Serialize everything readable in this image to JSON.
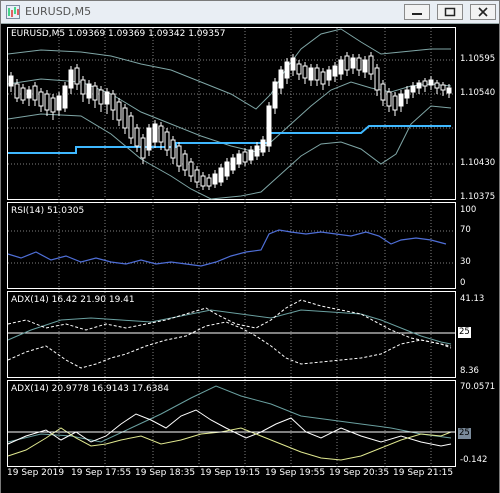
{
  "window": {
    "title": "EURUSD,M5",
    "buttons": [
      "minimize",
      "restore",
      "close"
    ]
  },
  "price_panel": {
    "header": "EURUSD,M5  1.09369 1.09369 1.09342 1.09357",
    "levels": [
      "1.10595",
      "1.10540",
      "1.10430",
      "1.10375"
    ]
  },
  "rsi_panel": {
    "header": "RSI(14) 51.0305",
    "levels": [
      "100",
      "70",
      "30",
      "0"
    ]
  },
  "adx_panel_1": {
    "header": "ADX(14) 16.42 21.90 19.41",
    "levels": [
      "41.13",
      "8.36"
    ],
    "tag": "25"
  },
  "adx_panel_2": {
    "header": "ADX(14) 20.9778 16.9143 17.6384",
    "levels": [
      "70.0571",
      "-0.142"
    ],
    "tag": "25"
  },
  "time_axis": [
    "19 Sep 2019",
    "19 Sep 17:55",
    "19 Sep 18:35",
    "19 Sep 19:15",
    "19 Sep 19:55",
    "19 Sep 20:35",
    "19 Sep 21:15"
  ],
  "colors": {
    "background": "#000000",
    "candles": "#ffffff",
    "ma_line": "#3fb8ff",
    "bands": "#7fa6a6",
    "rsi_line": "#4f6fd8",
    "adx_main": "#6aa0a0",
    "adx_plus": "#ffffff",
    "adx_minus": "#e0e890"
  }
}
